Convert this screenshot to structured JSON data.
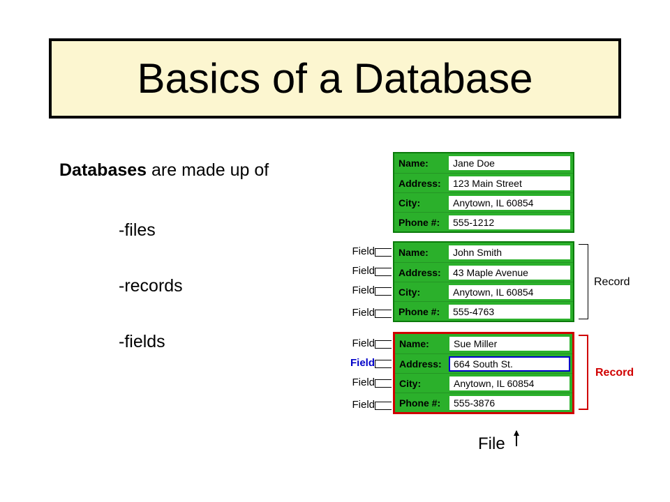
{
  "title": "Basics of a Database",
  "intro_bold": "Databases",
  "intro_rest": " are made up of",
  "bullets": {
    "b1": "-files",
    "b2": "-records",
    "b3": "-fields"
  },
  "labels": {
    "field": "Field",
    "record": "Record",
    "file": "File",
    "name": "Name:",
    "address": "Address:",
    "city": "City:",
    "phone": "Phone #:"
  },
  "cards": [
    {
      "name": "Jane Doe",
      "address": "123 Main Street",
      "city": "Anytown, IL 60854",
      "phone": "555-1212"
    },
    {
      "name": "John Smith",
      "address": "43 Maple Avenue",
      "city": "Anytown, IL 60854",
      "phone": "555-4763"
    },
    {
      "name": "Sue Miller",
      "address": "664 South St.",
      "city": "Anytown, IL 60854",
      "phone": "555-3876"
    }
  ]
}
